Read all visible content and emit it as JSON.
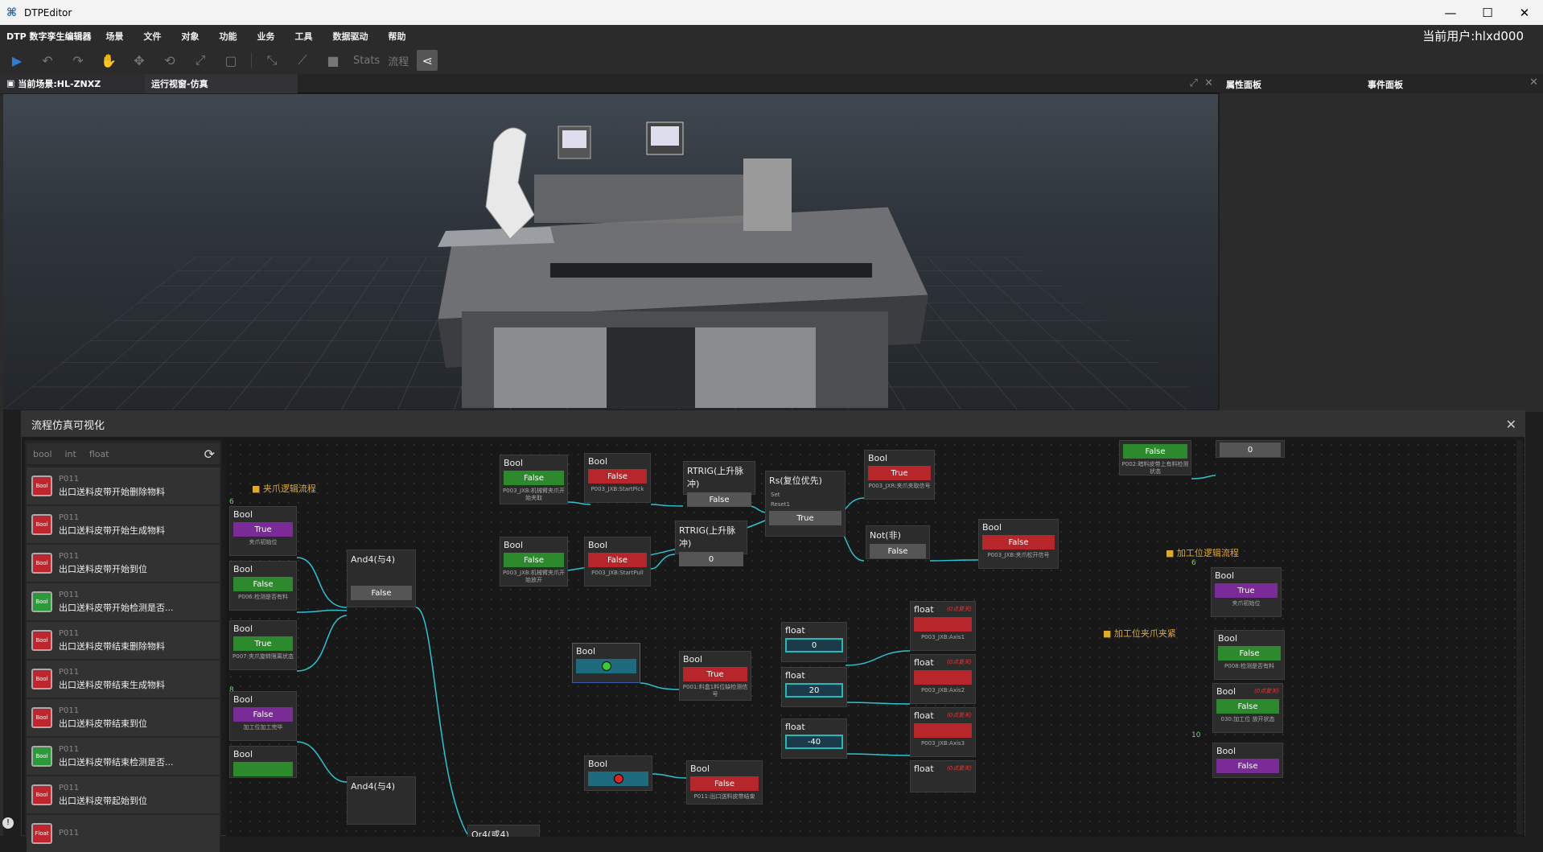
{
  "window": {
    "title": "DTPEditor",
    "min": "—",
    "max": "☐",
    "close": "✕"
  },
  "menu": {
    "brand": "DTP 数字孪生编辑器",
    "items": [
      "场景",
      "文件",
      "对象",
      "功能",
      "业务",
      "工具",
      "数据驱动",
      "帮助"
    ],
    "user": "当前用户:hlxd000"
  },
  "toolbar": {
    "stats": "Stats",
    "flow": "流程"
  },
  "tabs": {
    "scene": "当前场景:HL-ZNXZ",
    "runtime": "运行视窗-仿真"
  },
  "right_panels": {
    "properties": "属性面板",
    "events": "事件面板"
  },
  "flow_panel": {
    "title": "流程仿真可视化",
    "filters": [
      "bool",
      "int",
      "float"
    ],
    "variables": [
      {
        "code": "P011",
        "name": "出口送料皮带开始删除物料",
        "type": "Bool",
        "state": "red"
      },
      {
        "code": "P011",
        "name": "出口送料皮带开始生成物料",
        "type": "Bool",
        "state": "red"
      },
      {
        "code": "P011",
        "name": "出口送料皮带开始到位",
        "type": "Bool",
        "state": "red"
      },
      {
        "code": "P011",
        "name": "出口送料皮带开始检测是否...",
        "type": "Bool",
        "state": "green"
      },
      {
        "code": "P011",
        "name": "出口送料皮带结束删除物料",
        "type": "Bool",
        "state": "red"
      },
      {
        "code": "P011",
        "name": "出口送料皮带结束生成物料",
        "type": "Bool",
        "state": "red"
      },
      {
        "code": "P011",
        "name": "出口送料皮带结束到位",
        "type": "Bool",
        "state": "red"
      },
      {
        "code": "P011",
        "name": "出口送料皮带结束检测是否...",
        "type": "Bool",
        "state": "green"
      },
      {
        "code": "P011",
        "name": "出口送料皮带起始到位",
        "type": "Bool",
        "state": "red"
      },
      {
        "code": "P011",
        "name": "",
        "type": "Float",
        "state": "red"
      }
    ],
    "groups": {
      "gripper": "夹爪逻辑流程",
      "station": "加工位逻辑流程",
      "clamp": "加工位夹爪夹紧"
    },
    "counters": {
      "c1": "6",
      "c2": "8",
      "c3": "6",
      "c4": "10"
    },
    "nodes": {
      "b1": {
        "title": "Bool",
        "value": "True",
        "sub": "夹爪初始位"
      },
      "b2": {
        "title": "Bool",
        "value": "False",
        "sub": "P006:检测是否有料"
      },
      "b3": {
        "title": "Bool",
        "value": "True",
        "sub": "P007:夹爪旋转限离状态"
      },
      "b4": {
        "title": "Bool",
        "value": "False",
        "sub": "加工位加工完毕"
      },
      "b5": {
        "title": "Bool",
        "value": ""
      },
      "and1": {
        "title": "And4(与4)",
        "value": "False"
      },
      "and2": {
        "title": "And4(与4)"
      },
      "or1": {
        "title": "Or4(或4)"
      },
      "b6": {
        "title": "Bool",
        "value": "False",
        "sub": "P003_JXB:机械臂夹爪开始夹取"
      },
      "b7": {
        "title": "Bool",
        "value": "False",
        "sub": "P003_JXB:StartPick"
      },
      "b8": {
        "title": "Bool",
        "value": "False",
        "sub": "P003_JXB:机械臂夹爪开始放开"
      },
      "b9": {
        "title": "Bool",
        "value": "False",
        "sub": "P003_JXB:StartPull"
      },
      "rt1": {
        "title": "RTRIG(上升脉冲)",
        "value": "False"
      },
      "rt2": {
        "title": "RTRIG(上升脉冲)",
        "value": "0"
      },
      "rs": {
        "title": "Rs(复位优先)",
        "set": "Set",
        "reset": "Reset1",
        "value": "True"
      },
      "b10": {
        "title": "Bool",
        "value": "True",
        "sub": "P003_JXR:夹爪夹取信号"
      },
      "not1": {
        "title": "Not(非)",
        "value": "False"
      },
      "b11": {
        "title": "Bool",
        "value": "False",
        "sub": "P003_JXB:夹爪松开信号"
      },
      "b12": {
        "title": "Bool"
      },
      "b13": {
        "title": "Bool",
        "value": "True",
        "sub": "P001:料盒1料位缺检测信号"
      },
      "b14": {
        "title": "Bool"
      },
      "b15": {
        "title": "Bool",
        "value": "False",
        "sub": "P011:出口送料皮带结束"
      },
      "f1": {
        "title": "float",
        "value": "0"
      },
      "f2": {
        "title": "float",
        "value": "20"
      },
      "f3": {
        "title": "float",
        "value": "-40"
      },
      "f4": {
        "title": "float",
        "sub": "P003_JXB:Axis1",
        "ann": "(0点复关)"
      },
      "f5": {
        "title": "float",
        "sub": "P003_JXB:Axis2",
        "ann": "(0点复关)"
      },
      "f6": {
        "title": "float",
        "sub": "P003_JXB:Axis3",
        "ann": "(0点复关)"
      },
      "f7": {
        "title": "float",
        "ann": "(0点复关)"
      },
      "r1": {
        "value": "False",
        "sub": "P002:暗料皮带上有料检测状态"
      },
      "r2": {
        "value": "0"
      },
      "r3": {
        "title": "Bool",
        "value": "True",
        "sub": "夹爪初始位"
      },
      "r4": {
        "title": "Bool",
        "value": "False",
        "sub": "P008:检测是否有料"
      },
      "r5": {
        "title": "Bool",
        "value": "False",
        "sub": "030:加工位 放开状态",
        "ann": "(0点复关)"
      },
      "r6": {
        "title": "Bool",
        "value": "False"
      }
    }
  },
  "colors": {
    "accent": "#2bc4d4",
    "true_green": "#2c8a2c",
    "false_red": "#b7262b",
    "purple": "#7a2b98",
    "group_gold": "#e0a928"
  }
}
